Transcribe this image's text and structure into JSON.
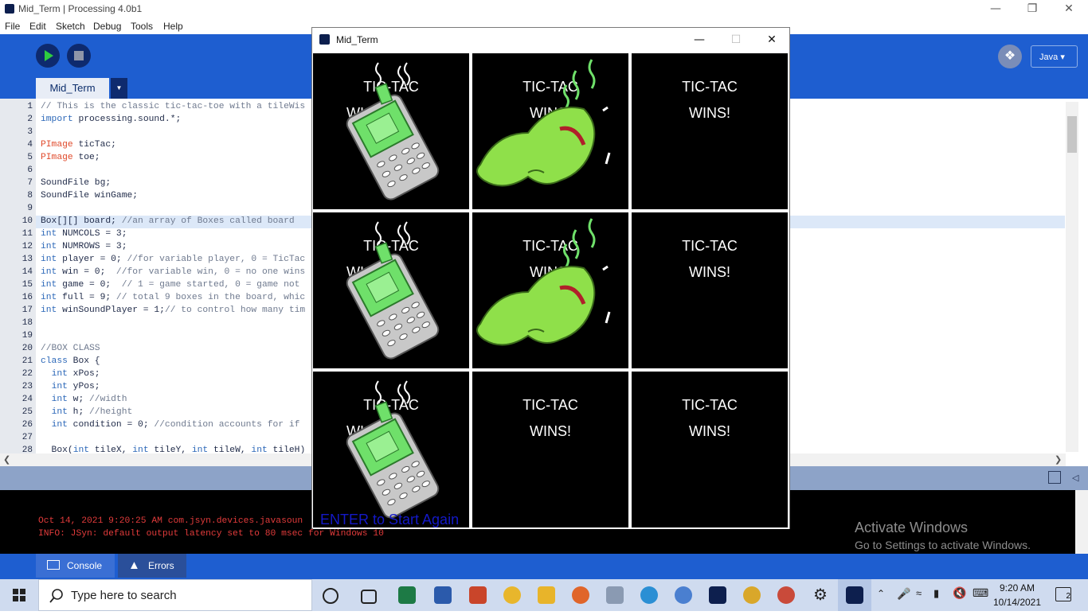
{
  "window": {
    "title": "Mid_Term | Processing 4.0b1"
  },
  "menu": [
    "File",
    "Edit",
    "Sketch",
    "Debug",
    "Tools",
    "Help"
  ],
  "toolbar": {
    "mode": "Java"
  },
  "editor_tab": "Mid_Term",
  "code_lines": [
    {
      "n": "1",
      "text": "// This is the classic tic-tac-toe with a tileWis"
    },
    {
      "n": "2",
      "text": "import processing.sound.*;"
    },
    {
      "n": "3",
      "text": ""
    },
    {
      "n": "4",
      "text": "PImage ticTac;"
    },
    {
      "n": "5",
      "text": "PImage toe;"
    },
    {
      "n": "6",
      "text": ""
    },
    {
      "n": "7",
      "text": "SoundFile bg;"
    },
    {
      "n": "8",
      "text": "SoundFile winGame;"
    },
    {
      "n": "9",
      "text": ""
    },
    {
      "n": "10",
      "text": "Box[][] board; //an array of Boxes called board"
    },
    {
      "n": "11",
      "text": "int NUMCOLS = 3;"
    },
    {
      "n": "12",
      "text": "int NUMROWS = 3;"
    },
    {
      "n": "13",
      "text": "int player = 0; //for variable player, 0 = TicTac"
    },
    {
      "n": "14",
      "text": "int win = 0;  //for variable win, 0 = no one wins"
    },
    {
      "n": "15",
      "text": "int game = 0;  // 1 = game started, 0 = game not"
    },
    {
      "n": "16",
      "text": "int full = 9; // total 9 boxes in the board, whic"
    },
    {
      "n": "17",
      "text": "int winSoundPlayer = 1;// to control how many tim"
    },
    {
      "n": "18",
      "text": ""
    },
    {
      "n": "19",
      "text": ""
    },
    {
      "n": "20",
      "text": "//BOX CLASS"
    },
    {
      "n": "21",
      "text": "class Box {"
    },
    {
      "n": "22",
      "text": "  int xPos;"
    },
    {
      "n": "23",
      "text": "  int yPos;"
    },
    {
      "n": "24",
      "text": "  int w; //width"
    },
    {
      "n": "25",
      "text": "  int h; //height"
    },
    {
      "n": "26",
      "text": "  int condition = 0; //condition accounts for if"
    },
    {
      "n": "27",
      "text": ""
    },
    {
      "n": "28",
      "text": "  Box(int tileX, int tileY, int tileW, int tileH)"
    }
  ],
  "console": {
    "line1": "Oct 14, 2021 9:20:25 AM com.jsyn.devices.javasoun",
    "line2": "INFO: JSyn: default output latency set to 80 msec for Windows 10",
    "tab_console": "Console",
    "tab_errors": "Errors"
  },
  "watermark": {
    "line1": "Activate Windows",
    "line2": "Go to Settings to activate Windows."
  },
  "sketch": {
    "title": "Mid_Term",
    "cell_line1": "TIC-TAC",
    "cell_line2": "WINS!",
    "cell_line2_partial": "WI",
    "restart_message": "ENTER to Start Again",
    "cells": [
      "phone",
      "pickle",
      "empty",
      "phone",
      "pickle",
      "empty",
      "phone",
      "empty",
      "empty"
    ]
  },
  "taskbar": {
    "search_placeholder": "Type here to search",
    "time": "9:20 AM",
    "date": "10/14/2021",
    "notifications": "2"
  },
  "colors": {
    "toolbar_blue": "#1e5ed0",
    "dark_navy": "#0e2a6e",
    "console_red": "#e23b3b",
    "restart_blue": "#1419c8"
  }
}
